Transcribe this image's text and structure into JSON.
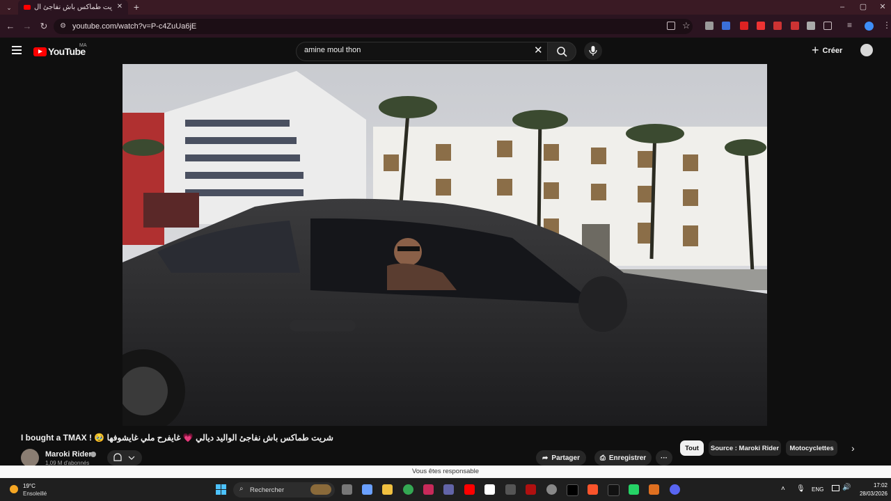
{
  "browser": {
    "tab_title": "شريت طماكس باش نفاجئ ال...",
    "url": "youtube.com/watch?v=P-c4ZuUa6jE",
    "window_controls": [
      "–",
      "▢",
      "✕"
    ]
  },
  "youtube": {
    "logo_text": "YouTube",
    "country_code": "MA",
    "search_query": "amine moul thon",
    "create_label": "Créer"
  },
  "video": {
    "title": "I bought a TMAX ! 🥹 شريت طماكس باش نفاجئ الواليد ديالي 💗 غايفرح ملي غايشوفها",
    "channel_name": "Maroki Rider",
    "subscribers": "1,09 M d'abonnés",
    "actions": {
      "share": "Partager",
      "save": "Enregistrer"
    }
  },
  "chips": [
    "Tout",
    "Source : Maroki Rider",
    "Motocyclettes"
  ],
  "banner_text": "Vous êtes responsable",
  "taskbar": {
    "temperature": "19°C",
    "weather": "Ensoleillé",
    "search_label": "Rechercher",
    "lang": "ENG",
    "time": "17:02",
    "date": "28/03/2026"
  },
  "icons": {
    "tab_favicon": "youtube-icon",
    "search": "search-icon",
    "mic": "microphone-icon",
    "bell": "bell-icon"
  },
  "colors": {
    "youtube_red": "#ff0000",
    "browser_frame": "#2b1420",
    "dark_bg": "#0f0f0f"
  }
}
